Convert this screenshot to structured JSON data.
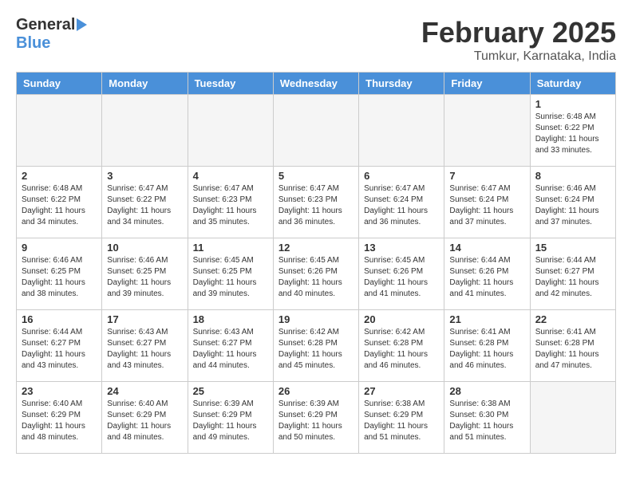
{
  "header": {
    "logo_general": "General",
    "logo_blue": "Blue",
    "month_title": "February 2025",
    "location": "Tumkur, Karnataka, India"
  },
  "weekdays": [
    "Sunday",
    "Monday",
    "Tuesday",
    "Wednesday",
    "Thursday",
    "Friday",
    "Saturday"
  ],
  "weeks": [
    [
      {
        "day": "",
        "info": ""
      },
      {
        "day": "",
        "info": ""
      },
      {
        "day": "",
        "info": ""
      },
      {
        "day": "",
        "info": ""
      },
      {
        "day": "",
        "info": ""
      },
      {
        "day": "",
        "info": ""
      },
      {
        "day": "1",
        "info": "Sunrise: 6:48 AM\nSunset: 6:22 PM\nDaylight: 11 hours and 33 minutes."
      }
    ],
    [
      {
        "day": "2",
        "info": "Sunrise: 6:48 AM\nSunset: 6:22 PM\nDaylight: 11 hours and 34 minutes."
      },
      {
        "day": "3",
        "info": "Sunrise: 6:47 AM\nSunset: 6:22 PM\nDaylight: 11 hours and 34 minutes."
      },
      {
        "day": "4",
        "info": "Sunrise: 6:47 AM\nSunset: 6:23 PM\nDaylight: 11 hours and 35 minutes."
      },
      {
        "day": "5",
        "info": "Sunrise: 6:47 AM\nSunset: 6:23 PM\nDaylight: 11 hours and 36 minutes."
      },
      {
        "day": "6",
        "info": "Sunrise: 6:47 AM\nSunset: 6:24 PM\nDaylight: 11 hours and 36 minutes."
      },
      {
        "day": "7",
        "info": "Sunrise: 6:47 AM\nSunset: 6:24 PM\nDaylight: 11 hours and 37 minutes."
      },
      {
        "day": "8",
        "info": "Sunrise: 6:46 AM\nSunset: 6:24 PM\nDaylight: 11 hours and 37 minutes."
      }
    ],
    [
      {
        "day": "9",
        "info": "Sunrise: 6:46 AM\nSunset: 6:25 PM\nDaylight: 11 hours and 38 minutes."
      },
      {
        "day": "10",
        "info": "Sunrise: 6:46 AM\nSunset: 6:25 PM\nDaylight: 11 hours and 39 minutes."
      },
      {
        "day": "11",
        "info": "Sunrise: 6:45 AM\nSunset: 6:25 PM\nDaylight: 11 hours and 39 minutes."
      },
      {
        "day": "12",
        "info": "Sunrise: 6:45 AM\nSunset: 6:26 PM\nDaylight: 11 hours and 40 minutes."
      },
      {
        "day": "13",
        "info": "Sunrise: 6:45 AM\nSunset: 6:26 PM\nDaylight: 11 hours and 41 minutes."
      },
      {
        "day": "14",
        "info": "Sunrise: 6:44 AM\nSunset: 6:26 PM\nDaylight: 11 hours and 41 minutes."
      },
      {
        "day": "15",
        "info": "Sunrise: 6:44 AM\nSunset: 6:27 PM\nDaylight: 11 hours and 42 minutes."
      }
    ],
    [
      {
        "day": "16",
        "info": "Sunrise: 6:44 AM\nSunset: 6:27 PM\nDaylight: 11 hours and 43 minutes."
      },
      {
        "day": "17",
        "info": "Sunrise: 6:43 AM\nSunset: 6:27 PM\nDaylight: 11 hours and 43 minutes."
      },
      {
        "day": "18",
        "info": "Sunrise: 6:43 AM\nSunset: 6:27 PM\nDaylight: 11 hours and 44 minutes."
      },
      {
        "day": "19",
        "info": "Sunrise: 6:42 AM\nSunset: 6:28 PM\nDaylight: 11 hours and 45 minutes."
      },
      {
        "day": "20",
        "info": "Sunrise: 6:42 AM\nSunset: 6:28 PM\nDaylight: 11 hours and 46 minutes."
      },
      {
        "day": "21",
        "info": "Sunrise: 6:41 AM\nSunset: 6:28 PM\nDaylight: 11 hours and 46 minutes."
      },
      {
        "day": "22",
        "info": "Sunrise: 6:41 AM\nSunset: 6:28 PM\nDaylight: 11 hours and 47 minutes."
      }
    ],
    [
      {
        "day": "23",
        "info": "Sunrise: 6:40 AM\nSunset: 6:29 PM\nDaylight: 11 hours and 48 minutes."
      },
      {
        "day": "24",
        "info": "Sunrise: 6:40 AM\nSunset: 6:29 PM\nDaylight: 11 hours and 48 minutes."
      },
      {
        "day": "25",
        "info": "Sunrise: 6:39 AM\nSunset: 6:29 PM\nDaylight: 11 hours and 49 minutes."
      },
      {
        "day": "26",
        "info": "Sunrise: 6:39 AM\nSunset: 6:29 PM\nDaylight: 11 hours and 50 minutes."
      },
      {
        "day": "27",
        "info": "Sunrise: 6:38 AM\nSunset: 6:29 PM\nDaylight: 11 hours and 51 minutes."
      },
      {
        "day": "28",
        "info": "Sunrise: 6:38 AM\nSunset: 6:30 PM\nDaylight: 11 hours and 51 minutes."
      },
      {
        "day": "",
        "info": ""
      }
    ]
  ]
}
